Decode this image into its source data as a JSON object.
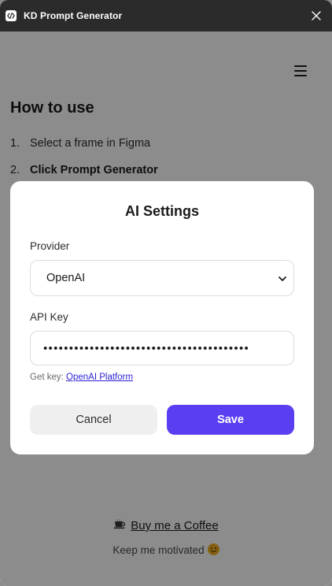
{
  "window": {
    "title": "KD Prompt Generator",
    "logo_icon": "code-brackets-icon",
    "close_icon": "close-icon"
  },
  "main": {
    "menu_icon": "hamburger-menu-icon",
    "how_to_title": "How to use",
    "steps": [
      {
        "number": "1.",
        "text": "Select a frame in Figma"
      },
      {
        "number": "2.",
        "text": "Click Prompt Generator"
      }
    ],
    "coffee_icon": "coffee-cup-icon",
    "coffee_link": "Buy me a Coffee",
    "motivated_text": "Keep me motivated",
    "motivated_icon": "smiling-face-icon"
  },
  "modal": {
    "title": "AI Settings",
    "provider_label": "Provider",
    "provider_value": "OpenAI",
    "api_key_label": "API Key",
    "api_key_masked": "••••••••••••••••••••••••••••••••••••••••",
    "get_key_prefix": "Get key:",
    "get_key_link": "OpenAI Platform",
    "cancel_label": "Cancel",
    "save_label": "Save"
  },
  "colors": {
    "titlebar": "#2b2b2b",
    "accent": "#5a3ff2",
    "link": "#2a1fd6",
    "overlay": "rgba(0,0,0,0.45)"
  }
}
